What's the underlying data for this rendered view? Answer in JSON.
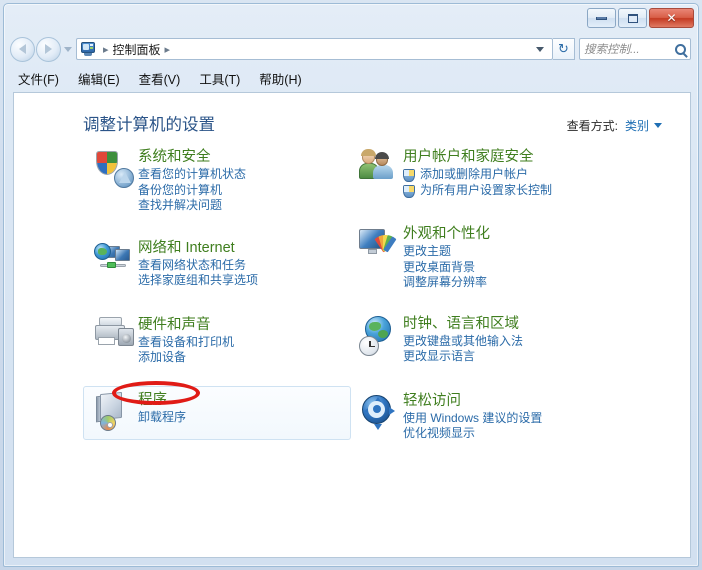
{
  "window": {
    "buttons": {
      "minimize": "minimize",
      "maximize": "maximize",
      "close": "✕"
    }
  },
  "address_bar": {
    "icon": "control-panel-icon",
    "separator": "▸",
    "crumb": "控制面板",
    "refresh_icon": "↻"
  },
  "search": {
    "placeholder": "搜索控制...",
    "icon": "search-icon"
  },
  "menu": {
    "items": [
      {
        "label": "文件(F)"
      },
      {
        "label": "编辑(E)"
      },
      {
        "label": "查看(V)"
      },
      {
        "label": "工具(T)"
      },
      {
        "label": "帮助(H)"
      }
    ]
  },
  "main": {
    "page_title": "调整计算机的设置",
    "view_by": {
      "label": "查看方式:",
      "value": "类别"
    },
    "categories_left": [
      {
        "icon": "security-shield-icon",
        "title": "系统和安全",
        "links": [
          {
            "label": "查看您的计算机状态",
            "shield": false
          },
          {
            "label": "备份您的计算机",
            "shield": false
          },
          {
            "label": "查找并解决问题",
            "shield": false
          }
        ],
        "highlighted": false
      },
      {
        "icon": "network-globe-icon",
        "title": "网络和 Internet",
        "links": [
          {
            "label": "查看网络状态和任务",
            "shield": false
          },
          {
            "label": "选择家庭组和共享选项",
            "shield": false
          }
        ],
        "highlighted": false
      },
      {
        "icon": "printer-speaker-icon",
        "title": "硬件和声音",
        "links": [
          {
            "label": "查看设备和打印机",
            "shield": false
          },
          {
            "label": "添加设备",
            "shield": false
          }
        ],
        "highlighted": false
      },
      {
        "icon": "programs-box-cd-icon",
        "title": "程序",
        "links": [
          {
            "label": "卸载程序",
            "shield": false
          }
        ],
        "highlighted": true
      }
    ],
    "categories_right": [
      {
        "icon": "users-people-icon",
        "title": "用户帐户和家庭安全",
        "links": [
          {
            "label": "添加或删除用户帐户",
            "shield": true
          },
          {
            "label": "为所有用户设置家长控制",
            "shield": true
          }
        ],
        "highlighted": false
      },
      {
        "icon": "appearance-monitor-icon",
        "title": "外观和个性化",
        "links": [
          {
            "label": "更改主题",
            "shield": false
          },
          {
            "label": "更改桌面背景",
            "shield": false
          },
          {
            "label": "调整屏幕分辨率",
            "shield": false
          }
        ],
        "highlighted": false
      },
      {
        "icon": "clock-globe-icon",
        "title": "时钟、语言和区域",
        "links": [
          {
            "label": "更改键盘或其他输入法",
            "shield": false
          },
          {
            "label": "更改显示语言",
            "shield": false
          }
        ],
        "highlighted": false
      },
      {
        "icon": "ease-of-access-icon",
        "title": "轻松访问",
        "links": [
          {
            "label": "使用 Windows 建议的设置",
            "shield": false
          },
          {
            "label": "优化视频显示",
            "shield": false
          }
        ],
        "highlighted": false
      }
    ]
  },
  "annotation": {
    "shape": "red-ellipse",
    "targets": "卸载程序",
    "color": "#e01b16"
  },
  "colors": {
    "category_title": "#3f7e1e",
    "link": "#2b6ba8",
    "page_title": "#2b5488",
    "annotation": "#e01b16"
  }
}
